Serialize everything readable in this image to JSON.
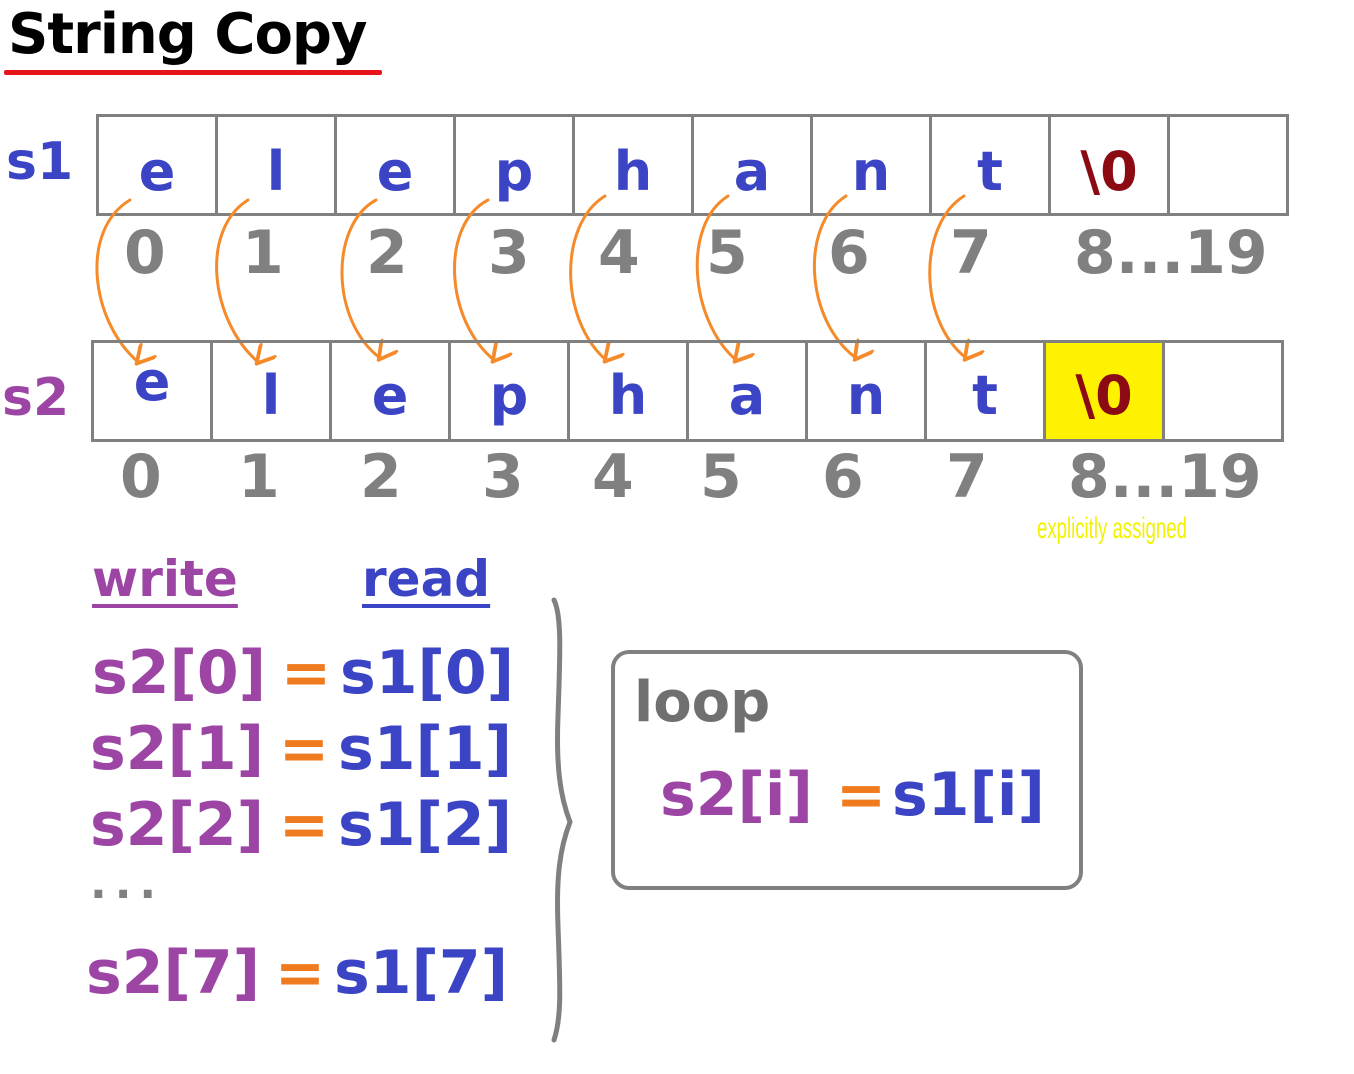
{
  "title": "String Copy",
  "arrays": {
    "s1": {
      "label": "s1",
      "cells": [
        "e",
        "l",
        "e",
        "p",
        "h",
        "a",
        "n",
        "t",
        "\\0",
        ""
      ],
      "indices": [
        "0",
        "1",
        "2",
        "3",
        "4",
        "5",
        "6",
        "7",
        "8...19"
      ]
    },
    "s2": {
      "label": "s2",
      "cells": [
        "e",
        "l",
        "e",
        "p",
        "h",
        "a",
        "n",
        "t",
        "\\0",
        ""
      ],
      "indices": [
        "0",
        "1",
        "2",
        "3",
        "4",
        "5",
        "6",
        "7",
        "8...19"
      ],
      "note": "explicitly assigned"
    }
  },
  "assignments": {
    "write_header": "write",
    "read_header": "read",
    "lines": [
      {
        "lhs": "s2[0]",
        "op": "=",
        "rhs": "s1[0]"
      },
      {
        "lhs": "s2[1]",
        "op": "=",
        "rhs": "s1[1]"
      },
      {
        "lhs": "s2[2]",
        "op": "=",
        "rhs": "s1[2]"
      },
      {
        "lhs": "s2[7]",
        "op": "=",
        "rhs": "s1[7]"
      }
    ],
    "ellipsis": "..."
  },
  "loop": {
    "title": "loop",
    "lhs": "s2[i]",
    "op": "=",
    "rhs": "s1[i]"
  },
  "colors": {
    "s1": "#3a44c4",
    "s2": "#9c45a4",
    "arrow": "#f58a2a",
    "operator": "#f07a1e",
    "null_char": "#8b0a14",
    "highlight": "#fff200",
    "title_underline": "#e8141c",
    "index": "#808080"
  }
}
